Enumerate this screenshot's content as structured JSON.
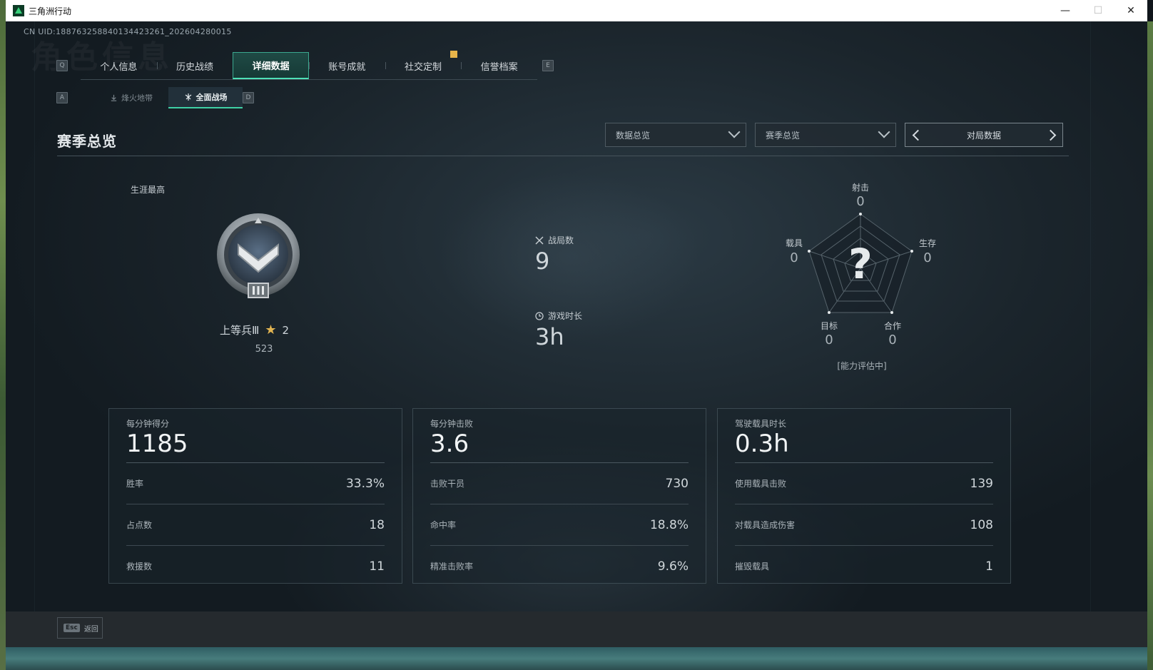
{
  "window": {
    "title": "三角洲行动",
    "minimize": "—",
    "maximize": "☐",
    "close": "✕"
  },
  "uid": "CN UID:1887632588401344232​61_202604280015",
  "ghost_title": "角色信息",
  "keys": {
    "q": "Q",
    "e": "E",
    "a": "A",
    "d": "D"
  },
  "tabs": [
    {
      "label": "个人信息",
      "active": false
    },
    {
      "label": "历史战绩",
      "active": false
    },
    {
      "label": "详细数据",
      "active": true
    },
    {
      "label": "账号成就",
      "active": false
    },
    {
      "label": "社交定制",
      "active": false
    },
    {
      "label": "信誉档案",
      "active": false
    }
  ],
  "subtabs": [
    {
      "label": "烽火地带",
      "icon": "flame-zone-icon",
      "active": false
    },
    {
      "label": "全面战场",
      "icon": "battlefield-icon",
      "active": true
    }
  ],
  "section": {
    "title": "赛季总览",
    "dropdown1": "数据总览",
    "dropdown2": "赛季总览",
    "pager_label": "对局数据"
  },
  "rank": {
    "career_label": "生涯最高",
    "name": "上等兵Ⅲ",
    "stars": "2",
    "score": "523",
    "tier_roman": "Ⅲ"
  },
  "center": {
    "matches_label": "战局数",
    "matches_value": "9",
    "time_label": "游戏时长",
    "time_value": "3h"
  },
  "radar": {
    "shoot": {
      "label": "射击",
      "value": "0"
    },
    "vehicle": {
      "label": "载具",
      "value": "0"
    },
    "survive": {
      "label": "生存",
      "value": "0"
    },
    "objective": {
      "label": "目标",
      "value": "0"
    },
    "coop": {
      "label": "合作",
      "value": "0"
    },
    "placeholder": "?",
    "note": "[能力评估中]"
  },
  "cards": [
    {
      "head_label": "每分钟得分",
      "head_value": "1185",
      "rows": [
        {
          "label": "胜率",
          "value": "33.3%"
        },
        {
          "label": "占点数",
          "value": "18"
        },
        {
          "label": "救援数",
          "value": "11"
        }
      ]
    },
    {
      "head_label": "每分钟击败",
      "head_value": "3.6",
      "rows": [
        {
          "label": "击败干员",
          "value": "730"
        },
        {
          "label": "命中率",
          "value": "18.8%"
        },
        {
          "label": "精准击败率",
          "value": "9.6%"
        }
      ]
    },
    {
      "head_label": "驾驶载具时长",
      "head_value": "0.3h",
      "rows": [
        {
          "label": "使用载具击败",
          "value": "139"
        },
        {
          "label": "对载具造成伤害",
          "value": "108"
        },
        {
          "label": "摧毁载具",
          "value": "1"
        }
      ]
    }
  ],
  "footer": {
    "esc_key": "Esc",
    "esc_label": "返回"
  },
  "colors": {
    "accent": "#3fd0a5",
    "star": "#e2b552",
    "marker": "#e8b54a"
  }
}
